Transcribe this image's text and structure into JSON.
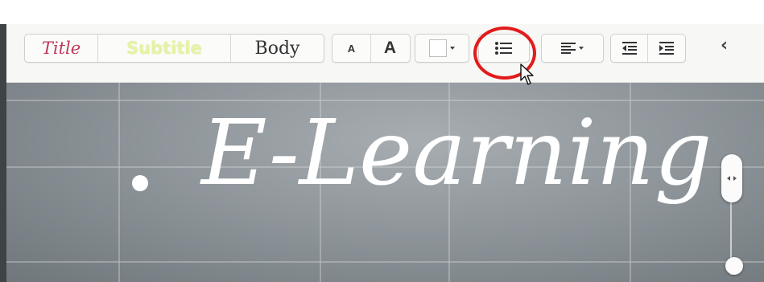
{
  "toolbar": {
    "styles": {
      "title": "Title",
      "subtitle": "Subtitle",
      "body": "Body"
    },
    "font_size": {
      "small": "A",
      "large": "A"
    },
    "color_swatch": {
      "icon": "color-swatch",
      "value": "#ffffff"
    },
    "buttons": [
      {
        "name": "bullet-list",
        "icon": "bulleted-list-icon",
        "highlighted": true
      },
      {
        "name": "alignment",
        "icon": "align-left-icon"
      },
      {
        "name": "decrease-indent",
        "icon": "outdent-icon"
      },
      {
        "name": "increase-indent",
        "icon": "indent-icon"
      }
    ],
    "collapse_icon": "chevron-left-icon",
    "collapse_glyph": "‹"
  },
  "canvas": {
    "heading": "E-Learning",
    "has_bullet": true
  },
  "colors": {
    "highlight": "#e21b1b",
    "title_style": "#c0395a",
    "subtitle_style": "#e7f2a5",
    "canvas_bg": "#8f969b"
  }
}
